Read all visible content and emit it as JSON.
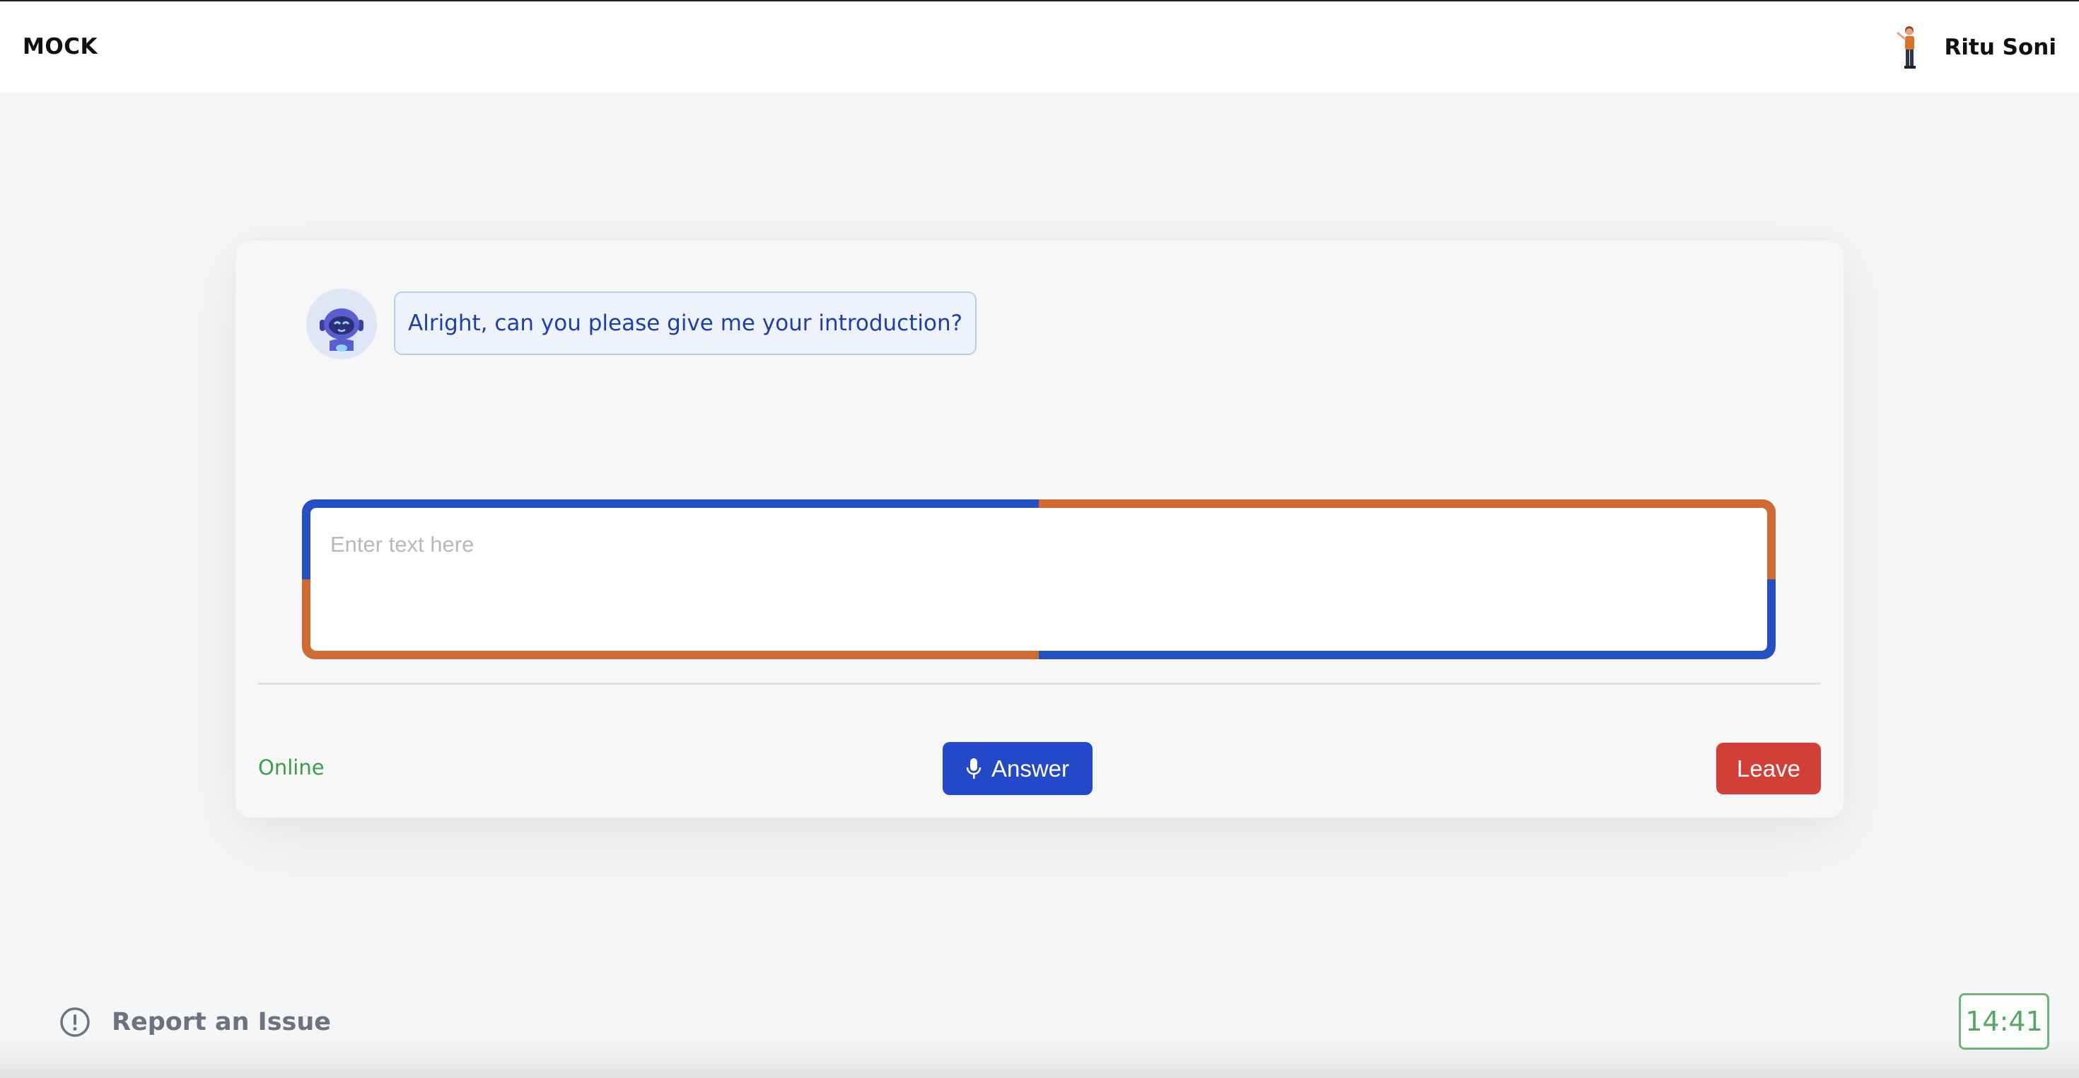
{
  "header": {
    "brand": "MOCK",
    "user_name": "Ritu Soni"
  },
  "chat": {
    "bot_message": "Alright, can you please give me your introduction?",
    "input_placeholder": "Enter text here"
  },
  "controls": {
    "status": "Online",
    "answer_label": "Answer",
    "leave_label": "Leave"
  },
  "footer": {
    "report_label": "Report an Issue",
    "timer": "14:41"
  },
  "colors": {
    "primary_blue": "#2348c8",
    "accent_orange": "#d06a34",
    "danger_red": "#d23f36",
    "online_green": "#3aa046"
  },
  "icons": {
    "user_avatar": "person-avatar-icon",
    "bot_avatar": "robot-avatar-icon",
    "answer": "microphone-icon",
    "report": "exclamation-circle-icon"
  }
}
